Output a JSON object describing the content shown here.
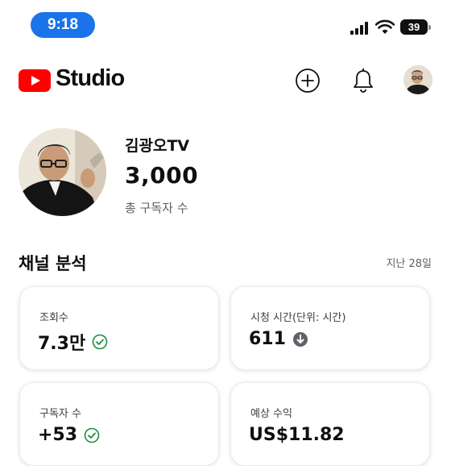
{
  "status_bar": {
    "time": "9:18",
    "battery": "39"
  },
  "header": {
    "brand": "Studio",
    "create_icon": "plus-circle",
    "notifications_icon": "bell"
  },
  "channel": {
    "name": "김광오TV",
    "subscribers": "3,000",
    "subscribers_label": "총 구독자 수"
  },
  "analytics": {
    "title": "채널 분석",
    "period": "지난 28일",
    "cards": [
      {
        "label": "조회수",
        "value": "7.3만",
        "icon": "check-circle"
      },
      {
        "label": "시청 시간(단위: 시간)",
        "value": "611",
        "icon": "arrow-down-circle"
      },
      {
        "label": "구독자 수",
        "value": "+53",
        "icon": "check-circle"
      },
      {
        "label": "예상 수익",
        "value": "US$11.82"
      }
    ]
  },
  "colors": {
    "youtube_red": "#ff0000",
    "accent_blue": "#1a73e8",
    "check_green": "#1e8e3e"
  }
}
